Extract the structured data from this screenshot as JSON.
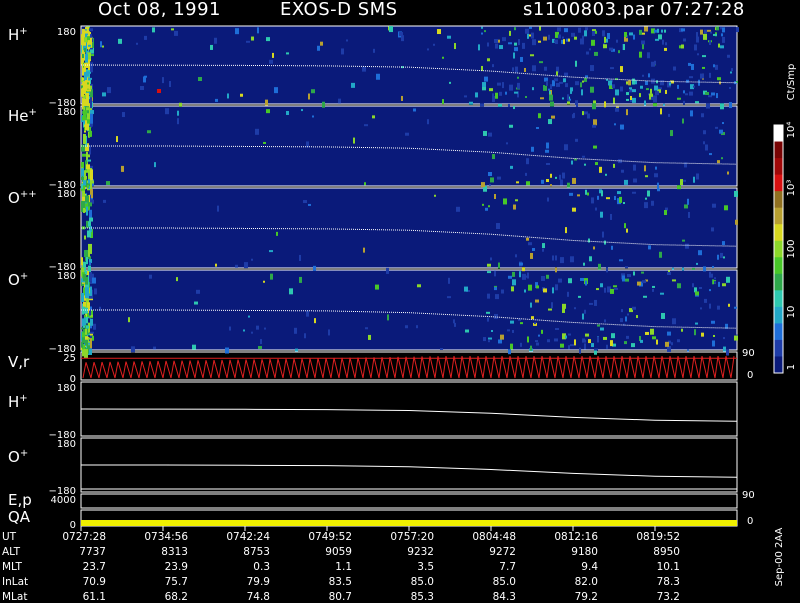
{
  "header": {
    "date": "Oct 08, 1991",
    "instrument": "EXOS-D SMS",
    "file": "s1100803.par",
    "time": "07:27:28"
  },
  "colorbar": {
    "unit_label": "Ct/Smp",
    "tick_labels": [
      "1",
      "10",
      "100",
      "10³",
      "10⁴"
    ],
    "colors": [
      "#0a1a7a",
      "#1e3ca8",
      "#1e6ed8",
      "#22a8c8",
      "#2ec8b0",
      "#2ea84a",
      "#48c828",
      "#8cd82a",
      "#d8d820",
      "#b8a030",
      "#907020",
      "#d81010",
      "#a00808",
      "#780404",
      "#ffffff"
    ]
  },
  "panels": [
    {
      "label": "H",
      "sup": "+",
      "top_tick": "180",
      "bottom_tick": "−180"
    },
    {
      "label": "He",
      "sup": "+",
      "top_tick": "180",
      "bottom_tick": "−180"
    },
    {
      "label": "O",
      "sup": "++",
      "top_tick": "180",
      "bottom_tick": "−180"
    },
    {
      "label": "O",
      "sup": "+",
      "top_tick": "180",
      "bottom_tick": "−180"
    },
    {
      "label": "V,r",
      "sup": "",
      "top_tick": "25",
      "bottom_tick": "0",
      "right_top": "90",
      "right_bottom": "0"
    },
    {
      "label": "H",
      "sup": "+",
      "top_tick": "180",
      "bottom_tick": "−180"
    },
    {
      "label": "O",
      "sup": "+",
      "top_tick": "180",
      "bottom_tick": "−180"
    },
    {
      "label": "E,p",
      "sup": "",
      "top_tick": "4000",
      "bottom_tick": "",
      "right_top": "90",
      "right_bottom": ""
    },
    {
      "label": "QA",
      "sup": "",
      "top_tick": "",
      "bottom_tick": "0",
      "right_top": "",
      "right_bottom": "0"
    }
  ],
  "date_stamp": "Sep-00 2AA",
  "ephemeris": {
    "labels": [
      "UT",
      "ALT",
      "MLT",
      "InLat",
      "MLat"
    ],
    "columns": [
      {
        "UT": "0727:28",
        "ALT": "7737",
        "MLT": "23.7",
        "InLat": "70.9",
        "MLat": "61.1"
      },
      {
        "UT": "0734:56",
        "ALT": "8313",
        "MLT": "23.9",
        "InLat": "75.7",
        "MLat": "68.2"
      },
      {
        "UT": "0742:24",
        "ALT": "8753",
        "MLT": "0.3",
        "InLat": "79.9",
        "MLat": "74.8"
      },
      {
        "UT": "0749:52",
        "ALT": "9059",
        "MLT": "1.1",
        "InLat": "83.5",
        "MLat": "80.7"
      },
      {
        "UT": "0757:20",
        "ALT": "9232",
        "MLT": "3.5",
        "InLat": "85.0",
        "MLat": "85.3"
      },
      {
        "UT": "0804:48",
        "ALT": "9272",
        "MLT": "7.7",
        "InLat": "85.0",
        "MLat": "84.3"
      },
      {
        "UT": "0812:16",
        "ALT": "9180",
        "MLT": "9.4",
        "InLat": "82.0",
        "MLat": "79.2"
      },
      {
        "UT": "0819:52",
        "ALT": "8950",
        "MLT": "10.1",
        "InLat": "78.3",
        "MLat": "73.2"
      }
    ]
  },
  "chart_data": {
    "type": "heatmap",
    "xlabel": "UT",
    "x_ticks": [
      "0727:28",
      "0734:56",
      "0742:24",
      "0749:52",
      "0757:20",
      "0804:48",
      "0812:16",
      "0819:52"
    ],
    "ylim": [
      -180,
      180
    ],
    "colorbar_scale": "log",
    "colorbar_range": [
      1,
      10000
    ],
    "background_level": 1,
    "series": [
      {
        "name": "H+",
        "pitch_angle_curve": [
          [
            0,
            0
          ],
          [
            1,
            -1
          ],
          [
            2,
            -2
          ],
          [
            3,
            -4
          ],
          [
            4,
            -10
          ],
          [
            5,
            -28
          ],
          [
            6,
            -56
          ],
          [
            7,
            -75
          ],
          [
            8,
            -82
          ]
        ]
      },
      {
        "name": "He+",
        "pitch_angle_curve": [
          [
            0,
            0
          ],
          [
            1,
            0
          ],
          [
            2,
            -2
          ],
          [
            3,
            -4
          ],
          [
            4,
            -10
          ],
          [
            5,
            -28
          ],
          [
            6,
            -56
          ],
          [
            7,
            -75
          ],
          [
            8,
            -82
          ]
        ]
      },
      {
        "name": "O++",
        "pitch_angle_curve": [
          [
            0,
            0
          ],
          [
            1,
            0
          ],
          [
            2,
            -2
          ],
          [
            3,
            -4
          ],
          [
            4,
            -10
          ],
          [
            5,
            -28
          ],
          [
            6,
            -56
          ],
          [
            7,
            -75
          ],
          [
            8,
            -82
          ]
        ]
      },
      {
        "name": "O+",
        "pitch_angle_curve": [
          [
            0,
            0
          ],
          [
            1,
            0
          ],
          [
            2,
            -2
          ],
          [
            3,
            -4
          ],
          [
            4,
            -12
          ],
          [
            5,
            -30
          ],
          [
            6,
            -56
          ],
          [
            7,
            -75
          ],
          [
            8,
            -82
          ]
        ]
      }
    ],
    "velocity_range": [
      0,
      25
    ]
  }
}
